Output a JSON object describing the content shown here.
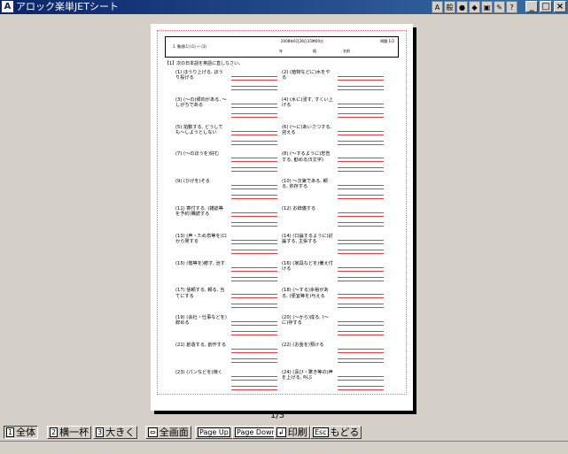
{
  "window": {
    "title": "アロック楽単JETシート"
  },
  "tray": [
    "A",
    "般",
    "",
    "",
    "",
    "",
    ""
  ],
  "sheet": {
    "header": {
      "left": "1. 動詞(1) (1) ～ (3)",
      "date": "2008年6月28日15時00分",
      "number": "問題 1/2",
      "year": "年",
      "class": "組",
      "name": "名前"
    },
    "instruction": "【1】次の日本語を英語に直しなさい。",
    "items": [
      "(1) ほうり上げる, ほうり投げる",
      "(2) (植物などに)水をやる",
      "(3) (～の)傾向がある, ～しがちである",
      "(4) (水に)浸す, すくい上げる",
      "(5) 拍動する, どうしても～しようとしない",
      "(6) (～に)あいさつする, 迎える",
      "(7) (～のほうを)好む",
      "(8) (～するように)忠告する, 勧める(5文字)",
      "(9) (ひげを)そる",
      "(10) ～次第である, 頼る, 依存する",
      "(11) 寄付する, (雑誌等を予約)購読する",
      "(12) お辞儀する",
      "(13) (声・ため息等を)口から発する",
      "(14) (口論するように)討論する, 主張する",
      "(15) (傷等を)癒す, 治す",
      "(16) (家具などを)備え付ける",
      "(17) 信頼する, 頼る, 当てにする",
      "(18) (～する)余裕がある, (便宜等を)与える",
      "(19) (会社・仕事などを)辞める",
      "(20) (～から)成る, (～に)存する",
      "(21) 創造する, 創作する",
      "(22) (お金を)預ける",
      "(23) (パンなどを)焼く",
      "(24) (喜び・驚き等の)声を上げる, 叫ぶ"
    ]
  },
  "page_indicator": "1/3",
  "toolbar": {
    "whole": {
      "key": "1",
      "label": "全体"
    },
    "fit_width": {
      "key": "2",
      "label": "横一杯"
    },
    "larger": {
      "key": "3",
      "label": "大きく"
    },
    "fullscreen": {
      "label": "全画面"
    },
    "prev": {
      "key": "Page Up",
      "label": "前頁"
    },
    "next": {
      "key": "Page Down",
      "label": "次頁"
    },
    "print": {
      "key": "↲",
      "label": "印刷"
    },
    "back": {
      "key": "Esc",
      "label": "もどる"
    }
  }
}
